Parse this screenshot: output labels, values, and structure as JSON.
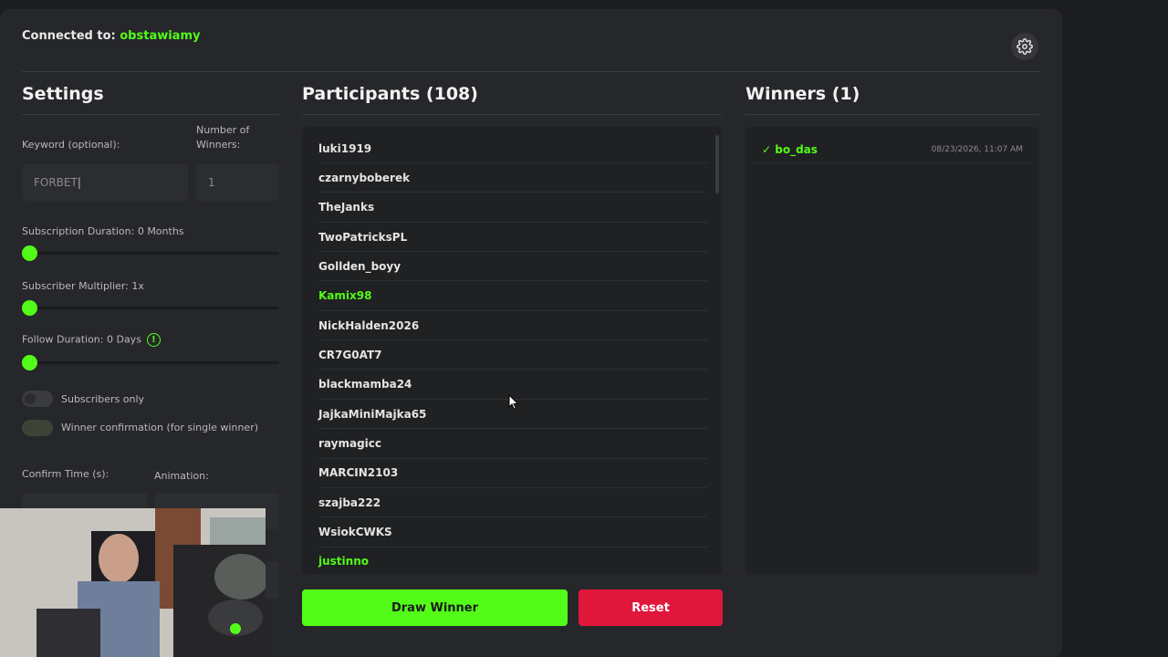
{
  "connection": {
    "prefix": "Connected to:",
    "channel": "obstawiamy"
  },
  "settings": {
    "title": "Settings",
    "keyword_label": "Keyword (optional):",
    "keyword_value": "FORBET",
    "winners_label_1": "Number of",
    "winners_label_2": "Winners:",
    "winners_value": "1",
    "sub_duration_label": "Subscription Duration: 0 Months",
    "sub_duration_value": 0,
    "multiplier_label": "Subscriber Multiplier: 1x",
    "multiplier_value": 1,
    "follow_label": "Follow Duration:  0  Days",
    "follow_value": 0,
    "subs_only_label": "Subscribers only",
    "subs_only": false,
    "confirm_label": "Winner confirmation (for single winner)",
    "confirm": false,
    "confirm_time_label": "Confirm Time (s):",
    "animation_label": "Animation:"
  },
  "participants": {
    "title": "Participants (108)",
    "items": [
      {
        "name": "luki1919",
        "highlight": false
      },
      {
        "name": "czarnyboberek",
        "highlight": false
      },
      {
        "name": "TheJanks",
        "highlight": false
      },
      {
        "name": "TwoPatricksPL",
        "highlight": false
      },
      {
        "name": "Gollden_boyy",
        "highlight": false
      },
      {
        "name": "Kamix98",
        "highlight": true
      },
      {
        "name": "NickHalden2026",
        "highlight": false
      },
      {
        "name": "CR7G0AT7",
        "highlight": false
      },
      {
        "name": "blackmamba24",
        "highlight": false
      },
      {
        "name": "JajkaMiniMajka65",
        "highlight": false
      },
      {
        "name": "raymagicc",
        "highlight": false
      },
      {
        "name": "MARCIN2103",
        "highlight": false
      },
      {
        "name": "szajba222",
        "highlight": false
      },
      {
        "name": "WsiokCWKS",
        "highlight": false
      },
      {
        "name": "justinno",
        "highlight": true
      }
    ]
  },
  "winners": {
    "title": "Winners (1)",
    "items": [
      {
        "name": "✓ bo_das",
        "date": "08/23/2026, 11:07 AM"
      }
    ]
  },
  "buttons": {
    "draw": "Draw Winner",
    "reset": "Reset"
  },
  "colors": {
    "accent": "#53fc18",
    "danger": "#e0173b",
    "panel": "#26272a"
  },
  "icons": {
    "settings": "gear-icon",
    "info": "info-icon",
    "cursor": "mouse-cursor"
  }
}
